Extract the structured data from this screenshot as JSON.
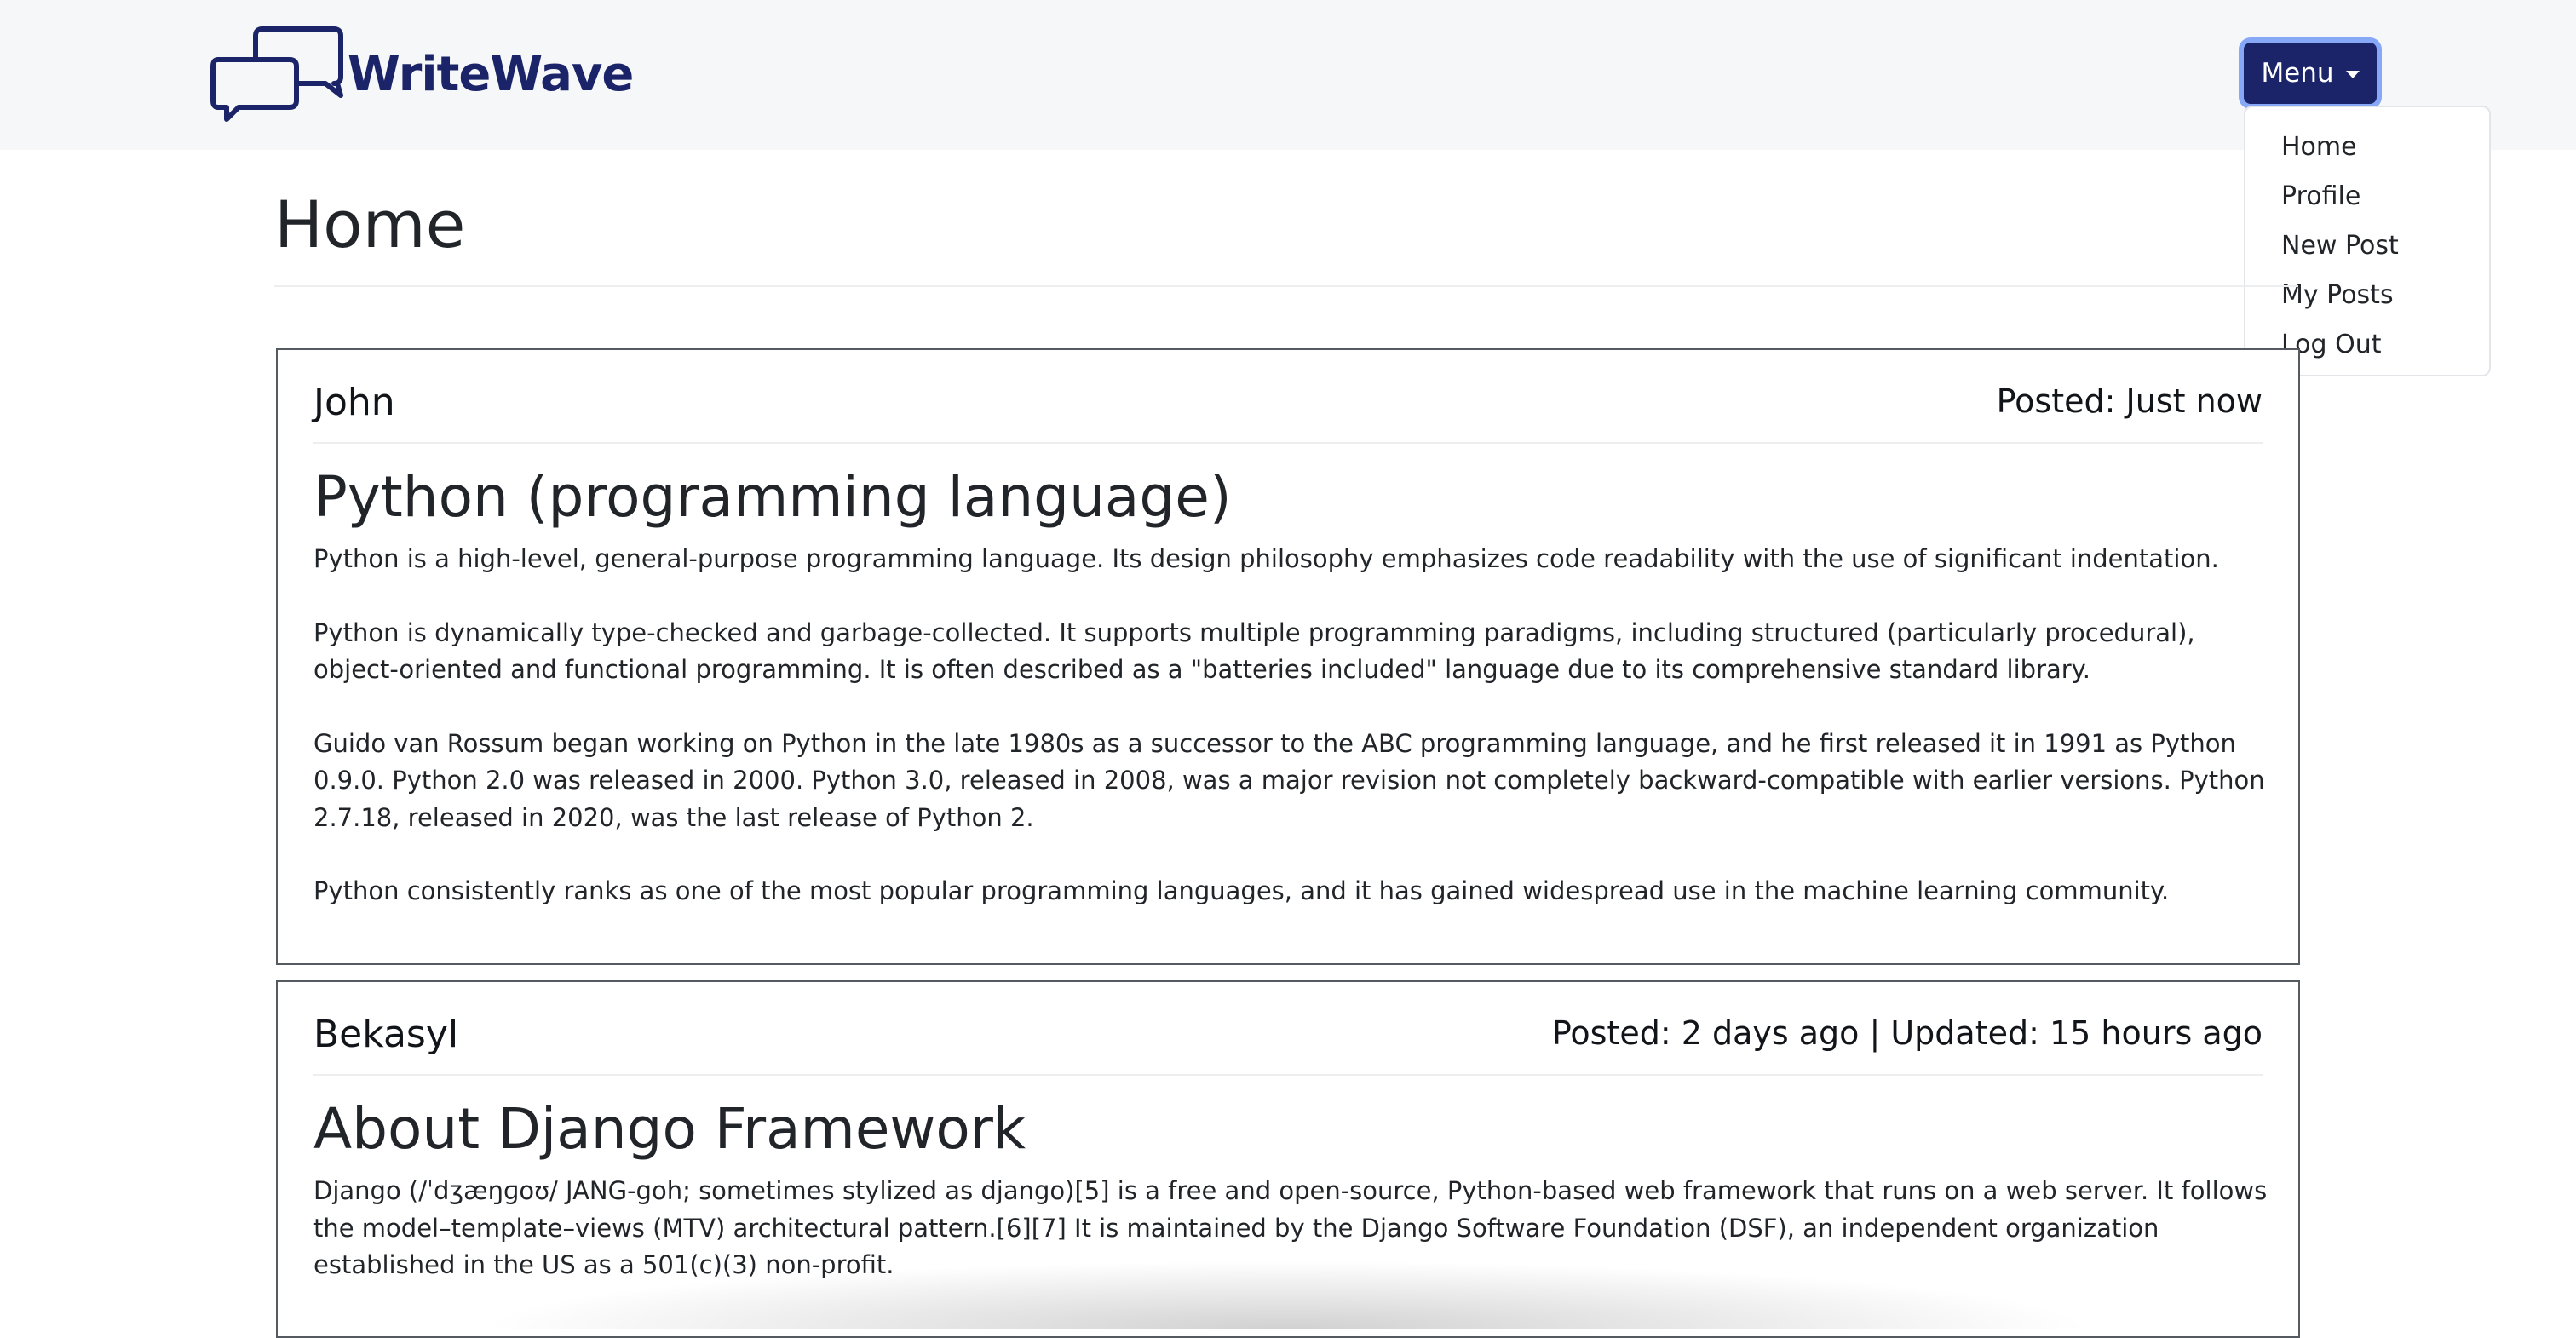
{
  "header": {
    "brand_name": "WriteWave",
    "logo_icon": "chat-bubbles-icon",
    "brand_color": "#1b2468",
    "menu_label": "Menu"
  },
  "menu": {
    "items": [
      {
        "label": "Home"
      },
      {
        "label": "Profile"
      },
      {
        "label": "New Post"
      },
      {
        "label": "My Posts"
      },
      {
        "label": "Log Out"
      }
    ]
  },
  "page": {
    "title": "Home"
  },
  "posts": [
    {
      "author": "John",
      "meta": "Posted: Just now",
      "title": "Python (programming language)",
      "paragraphs": [
        "Python is a high-level, general-purpose programming language. Its design philosophy emphasizes code readability with the use of significant indentation.",
        "Python is dynamically type-checked and garbage-collected. It supports multiple programming paradigms, including structured (particularly procedural), object-oriented and functional programming. It is often described as a \"batteries included\" language due to its comprehensive standard library.",
        "Guido van Rossum began working on Python in the late 1980s as a successor to the ABC programming language, and he first released it in 1991 as Python 0.9.0. Python 2.0 was released in 2000. Python 3.0, released in 2008, was a major revision not completely backward-compatible with earlier versions. Python 2.7.18, released in 2020, was the last release of Python 2.",
        "Python consistently ranks as one of the most popular programming languages, and it has gained widespread use in the machine learning community."
      ]
    },
    {
      "author": "Bekasyl",
      "meta": "Posted: 2 days ago | Updated: 15 hours ago",
      "title": "About Django Framework",
      "paragraphs": [
        "Django (/ˈdʒæŋɡoʊ/ JANG-goh; sometimes stylized as django)[5] is a free and open-source, Python-based web framework that runs on a web server. It follows the model–template–views (MTV) architectural pattern.[6][7] It is maintained by the Django Software Foundation (DSF), an independent organization established in the US as a 501(c)(3) non-profit."
      ]
    }
  ]
}
